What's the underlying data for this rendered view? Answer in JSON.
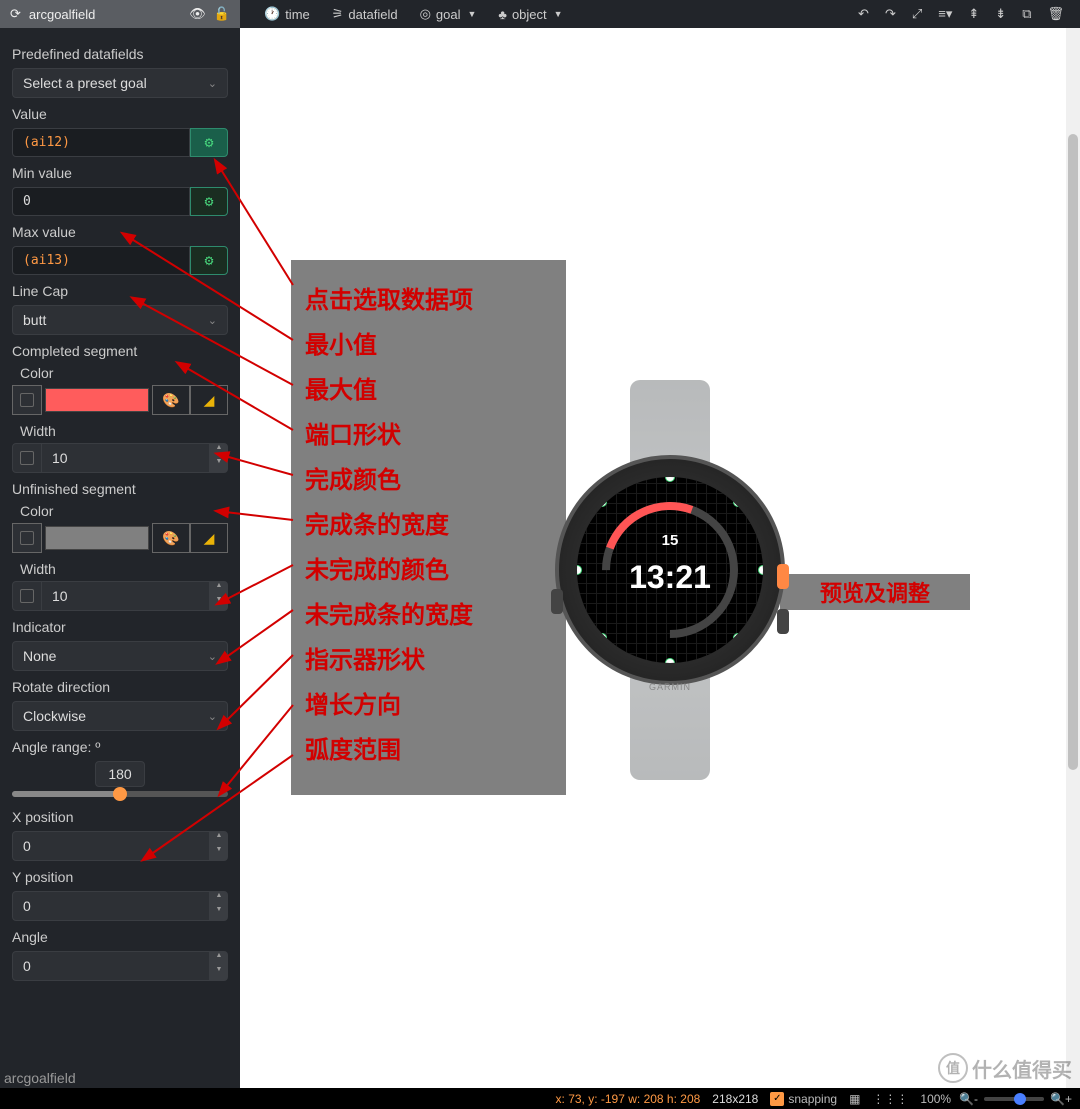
{
  "topbar": {
    "title": "arcgoalfield",
    "menu": {
      "time": "time",
      "datafield": "datafield",
      "goal": "goal",
      "object": "object"
    }
  },
  "sidebar": {
    "predef_label": "Predefined datafields",
    "predef_select": "Select a preset goal",
    "value_label": "Value",
    "value_input": "(ai12)",
    "min_label": "Min value",
    "min_input": "0",
    "max_label": "Max value",
    "max_input": "(ai13)",
    "linecap_label": "Line Cap",
    "linecap_select": "butt",
    "completed_label": "Completed segment",
    "color_label": "Color",
    "width_label": "Width",
    "completed_color": "#ff5c5c",
    "completed_width": "10",
    "unfinished_label": "Unfinished segment",
    "unfinished_color": "#808080",
    "unfinished_width": "10",
    "indicator_label": "Indicator",
    "indicator_select": "None",
    "rotate_label": "Rotate direction",
    "rotate_select": "Clockwise",
    "angle_label": "Angle range: º",
    "angle_value": "180",
    "xpos_label": "X position",
    "xpos_value": "0",
    "ypos_label": "Y position",
    "ypos_value": "0",
    "angle2_label": "Angle",
    "angle2_value": "0"
  },
  "annotations": {
    "l1": "点击选取数据项",
    "l2": "最小值",
    "l3": "最大值",
    "l4": "端口形状",
    "l5": "完成颜色",
    "l6": "完成条的宽度",
    "l7": "未完成的颜色",
    "l8": "未完成条的宽度",
    "l9": "指示器形状",
    "l10": "增长方向",
    "l11": "弧度范围",
    "right": "预览及调整"
  },
  "watch": {
    "date": "15",
    "time": "13:21",
    "brand": "GARMIN"
  },
  "statusbar": {
    "coords": "x: 73, y: -197 w: 208 h: 208",
    "dims": "218x218",
    "snapping": "snapping",
    "zoom": "100%"
  },
  "watermark": {
    "char": "值",
    "text": "什么值得买"
  },
  "bottom_label": "arcgoalfield"
}
